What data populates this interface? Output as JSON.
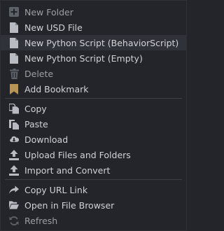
{
  "menu": {
    "items": [
      {
        "label": "New Folder",
        "icon": "add-folder-icon"
      },
      {
        "label": "New USD File",
        "icon": "file-icon"
      },
      {
        "label": "New Python Script (BehaviorScript)",
        "icon": "file-icon"
      },
      {
        "label": "New Python Script (Empty)",
        "icon": "file-icon"
      },
      {
        "label": "Delete",
        "icon": "trash-icon"
      },
      {
        "label": "Add Bookmark",
        "icon": "bookmark-icon"
      },
      {
        "label": "Copy",
        "icon": "copy-icon"
      },
      {
        "label": "Paste",
        "icon": "paste-icon"
      },
      {
        "label": "Download",
        "icon": "download-icon"
      },
      {
        "label": "Upload Files and Folders",
        "icon": "upload-icon"
      },
      {
        "label": "Import and Convert",
        "icon": "import-icon"
      },
      {
        "label": "Copy URL Link",
        "icon": "share-arrow-icon"
      },
      {
        "label": "Open in File Browser",
        "icon": "folder-open-icon"
      },
      {
        "label": "Refresh",
        "icon": "refresh-icon"
      }
    ]
  },
  "colors": {
    "background": "#23252a",
    "highlight": "#2f3238",
    "text": "#d0d2d6",
    "icon": "#b8bcc2",
    "icon_dim": "#5d6168",
    "bookmark": "#b89455",
    "separator": "#3c3f45"
  }
}
